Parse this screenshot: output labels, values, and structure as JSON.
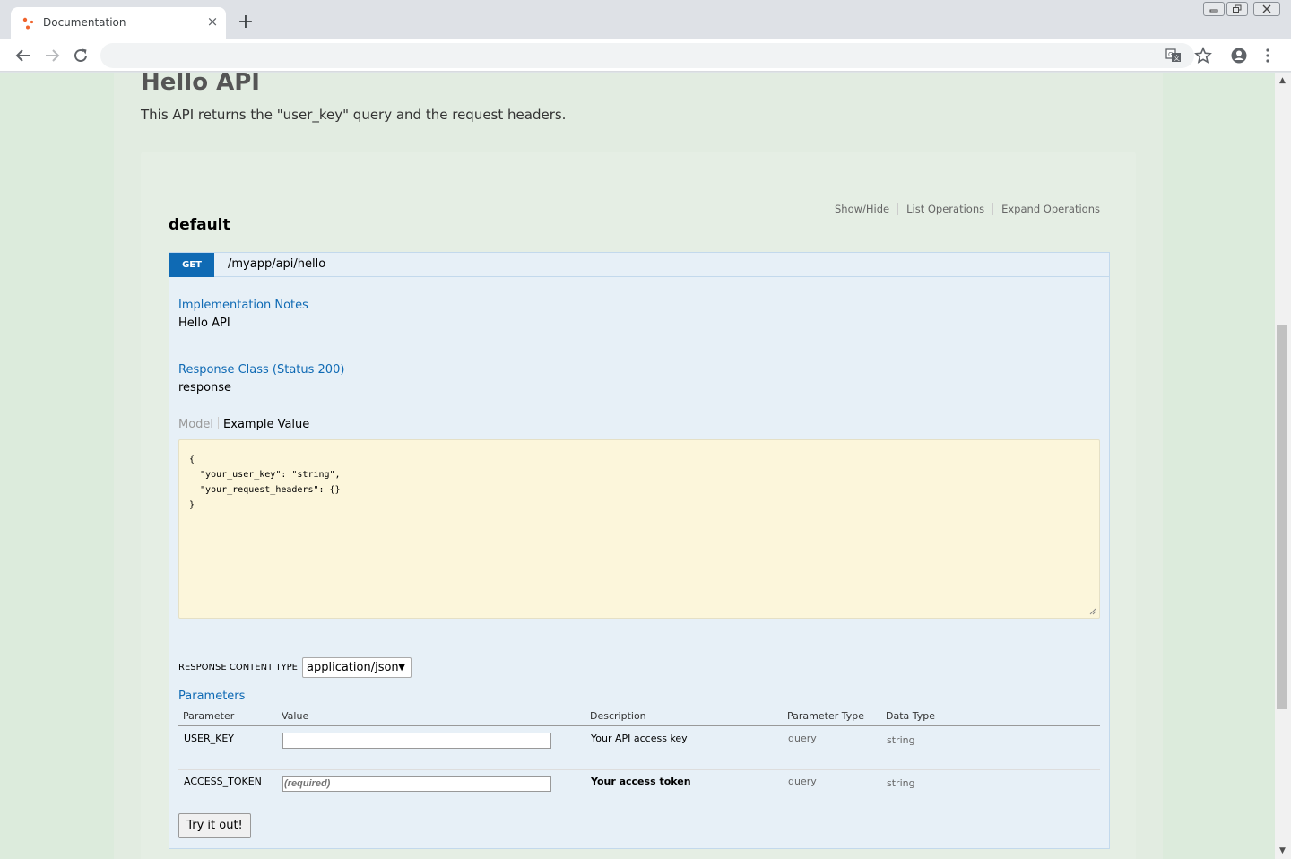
{
  "browser": {
    "tab_title": "Documentation",
    "tab_close": "×",
    "new_tab": "+"
  },
  "page": {
    "api_title": "Hello API",
    "api_description": "This API returns the \"user_key\" query and the request headers."
  },
  "resource": {
    "name": "default",
    "links": {
      "show_hide": "Show/Hide",
      "list_operations": "List Operations",
      "expand_operations": "Expand Operations"
    }
  },
  "operation": {
    "method": "GET",
    "path": "/myapp/api/hello",
    "impl_notes_heading": "Implementation Notes",
    "impl_notes": "Hello API",
    "response_class_heading": "Response Class (Status 200)",
    "response_class": "response",
    "signature_tabs": {
      "model": "Model",
      "example_value": "Example Value"
    },
    "example_lines": [
      "{",
      "  \"your_user_key\": \"string\",",
      "  \"your_request_headers\": {}",
      "}"
    ],
    "response_content_type_label": "RESPONSE CONTENT TYPE",
    "response_content_type_value": "application/json",
    "parameters_heading": "Parameters",
    "param_headers": {
      "parameter": "Parameter",
      "value": "Value",
      "description": "Description",
      "parameter_type": "Parameter Type",
      "data_type": "Data Type"
    },
    "params": [
      {
        "name": "USER_KEY",
        "value": "",
        "placeholder": "",
        "description": "Your API access key",
        "param_type": "query",
        "data_type": "string"
      },
      {
        "name": "ACCESS_TOKEN",
        "value": "",
        "placeholder": "(required)",
        "description": "Your access token",
        "param_type": "query",
        "data_type": "string"
      }
    ],
    "try_button": "Try it out!"
  },
  "colors": {
    "get_method": "#0f6ab4",
    "heading_blue": "#0f6ab4",
    "snippet_bg": "#fcf6db",
    "page_bg": "#dcebdc"
  }
}
